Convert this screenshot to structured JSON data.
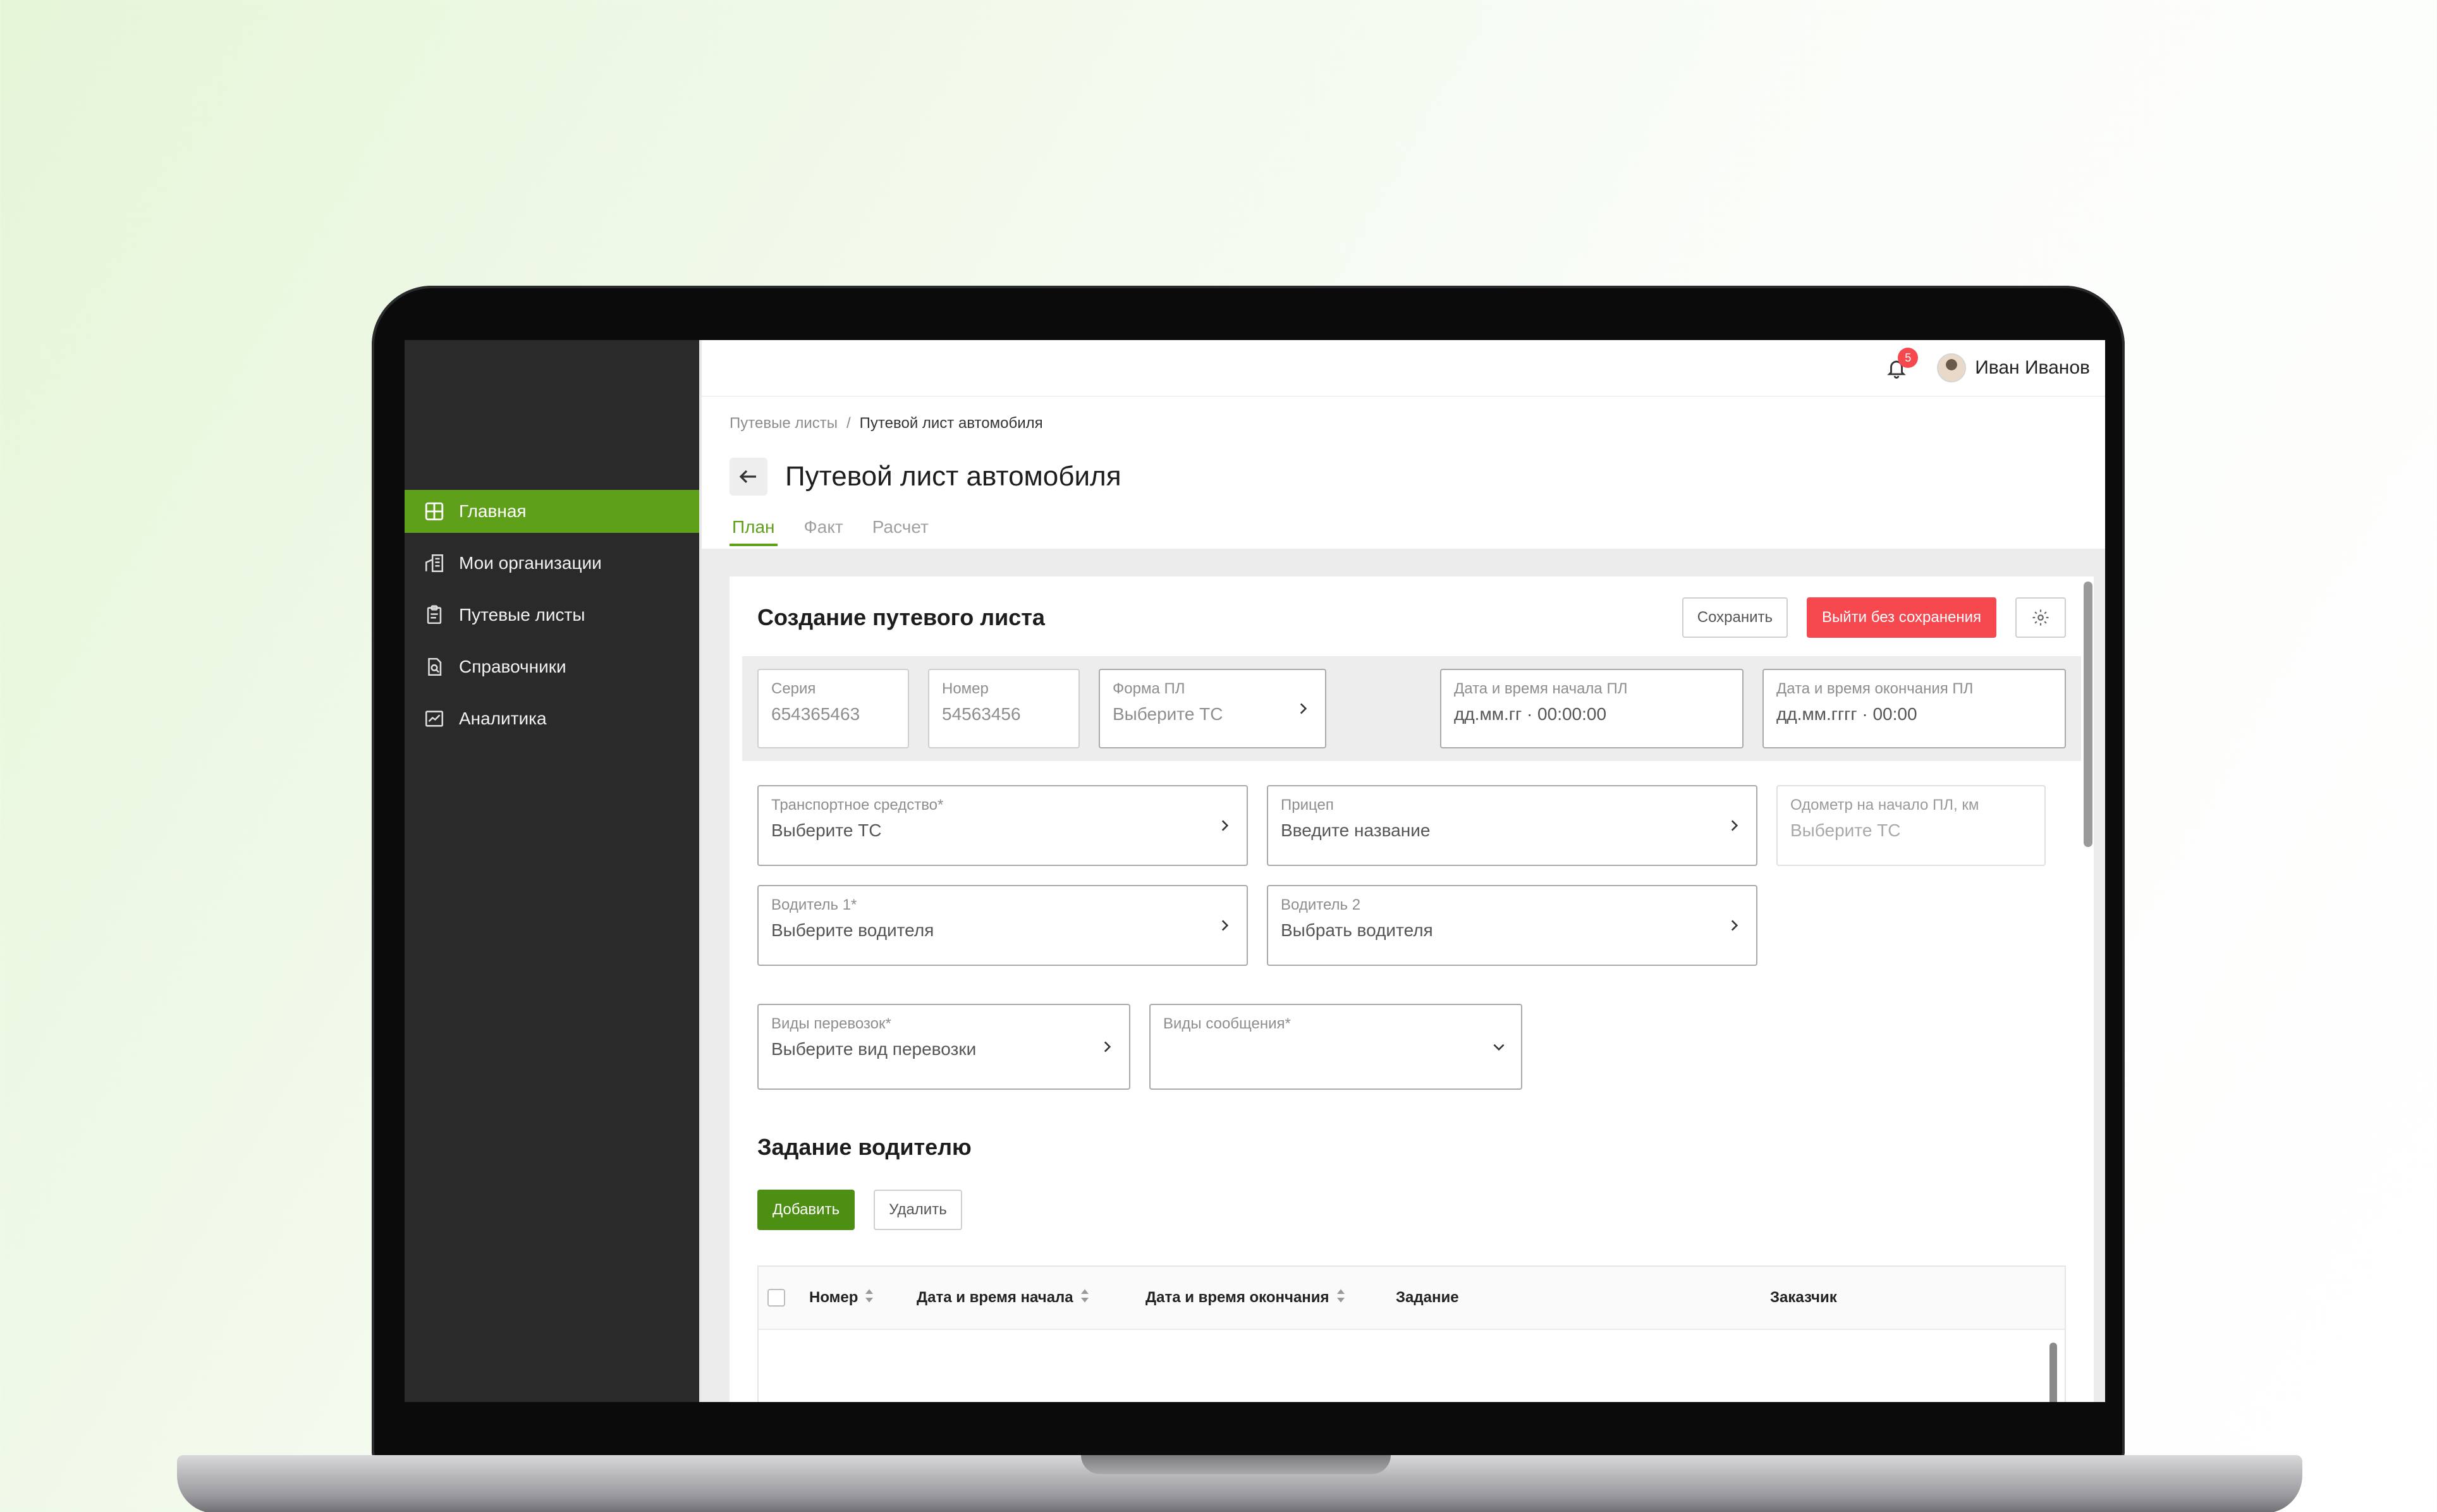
{
  "user": {
    "name": "Иван Иванов",
    "notifications": "5"
  },
  "nav": [
    {
      "label": "Главная",
      "icon": "home-grid-icon",
      "active": true
    },
    {
      "label": "Мои организации",
      "icon": "organization-icon"
    },
    {
      "label": "Путевые листы",
      "icon": "clipboard-icon"
    },
    {
      "label": "Справочники",
      "icon": "reference-book-icon"
    },
    {
      "label": "Аналитика",
      "icon": "analytics-icon"
    }
  ],
  "breadcrumb": {
    "parent": "Путевые листы",
    "separator": "/",
    "current": "Путевой лист автомобиля"
  },
  "page": {
    "title": "Путевой лист автомобиля"
  },
  "tabs": [
    {
      "label": "План",
      "active": true
    },
    {
      "label": "Факт"
    },
    {
      "label": "Расчет"
    }
  ],
  "card": {
    "title": "Создание путевого листа",
    "save_label": "Сохранить",
    "exit_label": "Выйти без сохранения"
  },
  "fields": {
    "series": {
      "label": "Серия",
      "value": "654365463"
    },
    "number": {
      "label": "Номер",
      "value": "54563456"
    },
    "form": {
      "label": "Форма ПЛ",
      "value": "Выберите ТС"
    },
    "start_dt": {
      "label": "Дата и время начала ПЛ",
      "value": "дд.мм.гг · 00:00:00"
    },
    "end_dt": {
      "label": "Дата и время окончания ПЛ",
      "value": "дд.мм.гггг · 00:00"
    },
    "vehicle": {
      "label": "Транспортное средство*",
      "value": "Выберите ТС"
    },
    "trailer": {
      "label": "Прицеп",
      "value": "Введите название"
    },
    "odometer": {
      "label": "Одометр на начало ПЛ, км",
      "value": "Выберите ТС"
    },
    "driver1": {
      "label": "Водитель 1*",
      "value": "Выберите водителя"
    },
    "driver2": {
      "label": "Водитель 2",
      "value": "Выбрать водителя"
    },
    "transport_type": {
      "label": "Виды перевозок*",
      "value": "Выберите вид перевозки"
    },
    "message_type": {
      "label": "Виды сообщения*",
      "value": ""
    }
  },
  "task_section": {
    "title": "Задание водителю",
    "add_label": "Добавить",
    "delete_label": "Удалить",
    "columns": [
      "Номер",
      "Дата и время начала",
      "Дата и время окончания",
      "Задание",
      "Заказчик"
    ]
  },
  "colors": {
    "accent": "#5fa01b",
    "danger": "#f5484f",
    "sidebar": "#2a2a2a"
  }
}
